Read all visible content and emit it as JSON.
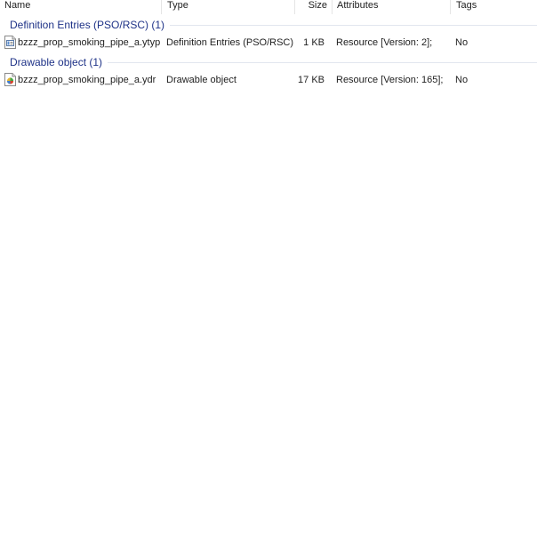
{
  "columns": {
    "name": "Name",
    "type": "Type",
    "size": "Size",
    "attributes": "Attributes",
    "tags": "Tags"
  },
  "groups": [
    {
      "title": "Definition Entries (PSO/RSC) (1)",
      "items": [
        {
          "name": "bzzz_prop_smoking_pipe_a.ytyp",
          "type": "Definition Entries (PSO/RSC)",
          "size": "1 KB",
          "attributes": "Resource [Version: 2];",
          "tags": "No",
          "icon": "ytyp-file-icon"
        }
      ]
    },
    {
      "title": "Drawable object (1)",
      "items": [
        {
          "name": "bzzz_prop_smoking_pipe_a.ydr",
          "type": "Drawable object",
          "size": "17 KB",
          "attributes": "Resource [Version: 165];",
          "tags": "No",
          "icon": "ydr-file-icon"
        }
      ]
    }
  ],
  "colors": {
    "group_title": "#1e3287",
    "group_line": "#e2e6ef",
    "text": "#1e1e1e"
  }
}
